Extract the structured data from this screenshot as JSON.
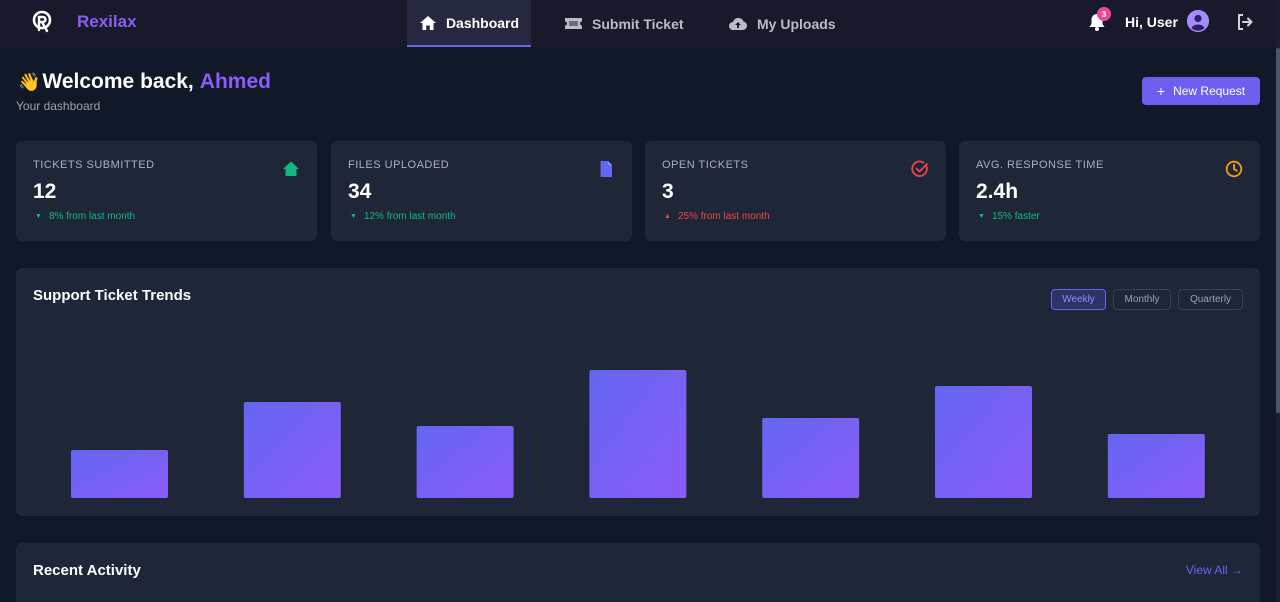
{
  "app": {
    "brand": "Rexilax"
  },
  "nav": {
    "items": [
      {
        "label": "Dashboard",
        "icon": "home-icon",
        "active": true
      },
      {
        "label": "Submit Ticket",
        "icon": "ticket-icon",
        "active": false
      },
      {
        "label": "My Uploads",
        "icon": "cloud-upload-icon",
        "active": false
      }
    ],
    "notifications_count": "3",
    "greeting": "Hi, User"
  },
  "welcome": {
    "prefix": "Welcome back,",
    "wave": "👋",
    "name": "Ahmed",
    "subtitle": "Your dashboard",
    "new_request_label": "New Request"
  },
  "stats": [
    {
      "label": "TICKETS SUBMITTED",
      "value": "12",
      "delta": "8% from last month",
      "trend": "down",
      "icon": "home-icon",
      "color": "#10b981"
    },
    {
      "label": "FILES UPLOADED",
      "value": "34",
      "delta": "12% from last month",
      "trend": "down",
      "icon": "file-icon",
      "color": "#6366f1"
    },
    {
      "label": "OPEN TICKETS",
      "value": "3",
      "delta": "25% from last month",
      "trend": "up",
      "icon": "check-circle-icon",
      "color": "#ef4444"
    },
    {
      "label": "AVG. RESPONSE TIME",
      "value": "2.4h",
      "delta": "15% faster",
      "trend": "down",
      "icon": "clock-icon",
      "color": "#f59e0b"
    }
  ],
  "chart_panel": {
    "title": "Support Ticket Trends",
    "periods": [
      {
        "label": "Weekly",
        "active": true
      },
      {
        "label": "Monthly",
        "active": false
      },
      {
        "label": "Quarterly",
        "active": false
      }
    ]
  },
  "chart_data": {
    "type": "bar",
    "categories": [],
    "values": [
      30,
      60,
      45,
      80,
      50,
      70,
      40
    ],
    "ylim": [
      0,
      100
    ],
    "grid": false,
    "colors": {
      "start": "#6366f1",
      "end": "#8b5cf6"
    }
  },
  "activity": {
    "title": "Recent Activity",
    "view_all_label": "View All →"
  }
}
